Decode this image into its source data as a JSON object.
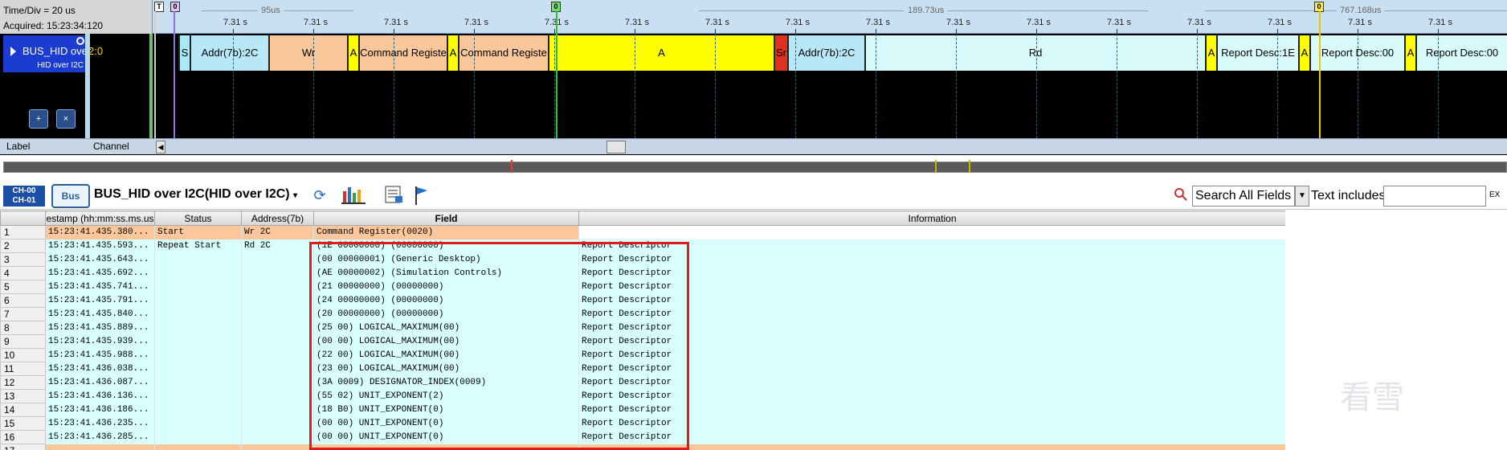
{
  "header": {
    "time_div": "Time/Div = 20 us",
    "acquired": "Acquired: 15:23:34:120"
  },
  "ruler": {
    "top_labels": [
      "95us",
      "189.73us",
      "767.168us"
    ],
    "tick_label": "7.31 s",
    "cursors": [
      "T",
      "0",
      "0",
      "0"
    ]
  },
  "channel": {
    "name": "BUS_HID over",
    "subtitle": "HID over I2C",
    "pin": "2:0"
  },
  "bus_segments": [
    {
      "label": "S",
      "color": "#a8e8f8"
    },
    {
      "label": "Addr(7b):2C",
      "color": "#b8e8f8"
    },
    {
      "label": "Wr",
      "color": "#f9c79a"
    },
    {
      "label": "A",
      "color": "#ffff00"
    },
    {
      "label": "Command Registe",
      "color": "#f9c79a"
    },
    {
      "label": "A",
      "color": "#ffff00"
    },
    {
      "label": "Command Registe",
      "color": "#f9c79a"
    },
    {
      "label": "A",
      "color": "#ffff00"
    },
    {
      "label": "Sr",
      "color": "#e0301e"
    },
    {
      "label": "Addr(7b):2C",
      "color": "#b8e8f8"
    },
    {
      "label": "Rd",
      "color": "#d9fafa"
    },
    {
      "label": "A",
      "color": "#ffff00"
    },
    {
      "label": "Report Desc:1E",
      "color": "#d9fafa"
    },
    {
      "label": "A",
      "color": "#ffff00"
    },
    {
      "label": "Report Desc:00",
      "color": "#d9fafa"
    },
    {
      "label": "A",
      "color": "#ffff00"
    },
    {
      "label": "Report Desc:00",
      "color": "#d9fafa"
    }
  ],
  "bottom_labels": {
    "label": "Label",
    "channel": "Channel"
  },
  "toolbar": {
    "ch_badge_top": "CH-00",
    "ch_badge_bottom": "CH-01",
    "bus_icon": "Bus",
    "bus_title": "BUS_HID over I2C(HID over I2C)",
    "search_field": "Search All Fields",
    "text_includes": "Text includes",
    "filter_value": "",
    "ex": "EX"
  },
  "table": {
    "columns": [
      "estamp (hh:mm:ss.ms.us",
      "Status",
      "Address(7b)",
      "Field",
      "Information"
    ],
    "rows": [
      {
        "n": "1",
        "ts": "15:23:41.435.380...",
        "status": "Start",
        "addr": "Wr 2C",
        "field": "Command Register(0020)",
        "info": "",
        "style": "orange"
      },
      {
        "n": "2",
        "ts": "15:23:41.435.593...",
        "status": "Repeat Start",
        "addr": "Rd 2C",
        "field": "(1E 00000000)  (00000000)",
        "info": "Report Descriptor",
        "style": "cyan"
      },
      {
        "n": "3",
        "ts": "15:23:41.435.643...",
        "status": "",
        "addr": "",
        "field": "(00 00000001)  (Generic Desktop)",
        "info": "Report Descriptor",
        "style": "cyan"
      },
      {
        "n": "4",
        "ts": "15:23:41.435.692...",
        "status": "",
        "addr": "",
        "field": "(AE 00000002)  (Simulation Controls)",
        "info": "Report Descriptor",
        "style": "cyan"
      },
      {
        "n": "5",
        "ts": "15:23:41.435.741...",
        "status": "",
        "addr": "",
        "field": "(21 00000000)  (00000000)",
        "info": "Report Descriptor",
        "style": "cyan"
      },
      {
        "n": "6",
        "ts": "15:23:41.435.791...",
        "status": "",
        "addr": "",
        "field": "(24 00000000)  (00000000)",
        "info": "Report Descriptor",
        "style": "cyan"
      },
      {
        "n": "7",
        "ts": "15:23:41.435.840...",
        "status": "",
        "addr": "",
        "field": "(20 00000000)  (00000000)",
        "info": "Report Descriptor",
        "style": "cyan"
      },
      {
        "n": "8",
        "ts": "15:23:41.435.889...",
        "status": "",
        "addr": "",
        "field": "(25 00)  LOGICAL_MAXIMUM(00)",
        "info": "Report Descriptor",
        "style": "cyan"
      },
      {
        "n": "9",
        "ts": "15:23:41.435.939...",
        "status": "",
        "addr": "",
        "field": "(00 00)  LOGICAL_MAXIMUM(00)",
        "info": "Report Descriptor",
        "style": "cyan"
      },
      {
        "n": "10",
        "ts": "15:23:41.435.988...",
        "status": "",
        "addr": "",
        "field": "(22 00)  LOGICAL_MAXIMUM(00)",
        "info": "Report Descriptor",
        "style": "cyan"
      },
      {
        "n": "11",
        "ts": "15:23:41.436.038...",
        "status": "",
        "addr": "",
        "field": "(23 00)  LOGICAL_MAXIMUM(00)",
        "info": "Report Descriptor",
        "style": "cyan"
      },
      {
        "n": "12",
        "ts": "15:23:41.436.087...",
        "status": "",
        "addr": "",
        "field": "(3A 0009)  DESIGNATOR_INDEX(0009)",
        "info": "Report Descriptor",
        "style": "cyan"
      },
      {
        "n": "13",
        "ts": "15:23:41.436.136...",
        "status": "",
        "addr": "",
        "field": "(55 02)  UNIT_EXPONENT(2)",
        "info": "Report Descriptor",
        "style": "cyan"
      },
      {
        "n": "14",
        "ts": "15:23:41.436.186...",
        "status": "",
        "addr": "",
        "field": "(18 B0)  UNIT_EXPONENT(0)",
        "info": "Report Descriptor",
        "style": "cyan"
      },
      {
        "n": "15",
        "ts": "15:23:41.436.235...",
        "status": "",
        "addr": "",
        "field": "(00 00)  UNIT_EXPONENT(0)",
        "info": "Report Descriptor",
        "style": "cyan"
      },
      {
        "n": "16",
        "ts": "15:23:41.436.285...",
        "status": "",
        "addr": "",
        "field": "(00 00)  UNIT_EXPONENT(0)",
        "info": "Report Descriptor",
        "style": "cyan"
      },
      {
        "n": "17",
        "ts": "",
        "status": "",
        "addr": "",
        "field": "",
        "info": "",
        "style": "orange"
      }
    ]
  },
  "watermark": "看雪"
}
